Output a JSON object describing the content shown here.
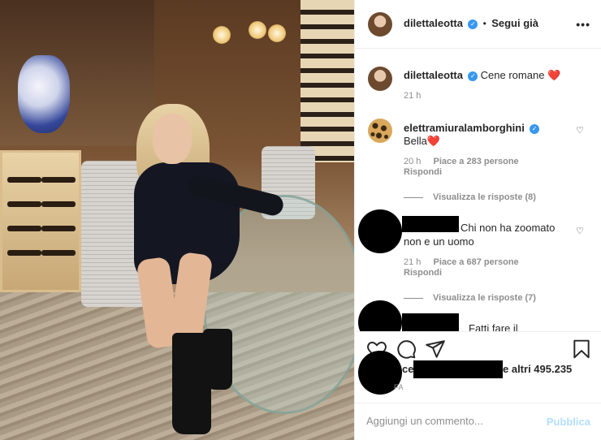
{
  "header": {
    "username": "dilettaleotta",
    "separator": "•",
    "follow_label": "Segui già",
    "more_label": "•••"
  },
  "caption": {
    "username": "dilettaleotta",
    "text": "Cene romane ❤️",
    "time": "21 h"
  },
  "comments": [
    {
      "username": "elettramiuralamborghini",
      "text": "Bella❤️",
      "time": "20 h",
      "likes": "Piace a 283 persone",
      "reply": "Rispondi",
      "view_replies": "Visualizza le risposte (8)"
    },
    {
      "username": "",
      "text_line1": "Chi non ha zoomato",
      "text_line2": "non e un uomo",
      "time": "21 h",
      "likes": "Piace a 687 persone",
      "reply": "Rispondi",
      "view_replies": "Visualizza le risposte (7)"
    },
    {
      "text_partial": "Fatti fare il"
    }
  ],
  "likes": {
    "prefix": "ce",
    "suffix": "e altri 495.235"
  },
  "timeago": "FA",
  "comment_box": {
    "placeholder": "Aggiungi un commento...",
    "publish_label": "Pubblica"
  },
  "icons": {
    "heart": "heart-icon",
    "comment": "comment-icon",
    "share": "paper-plane-icon",
    "save": "bookmark-icon",
    "verified": "verified-badge-icon",
    "more": "more-options-icon"
  },
  "colors": {
    "verified_blue": "#3897f0",
    "muted_text": "#8e8e8e",
    "publish_disabled": "#b2dffc",
    "heart_red": "#ed4956"
  }
}
